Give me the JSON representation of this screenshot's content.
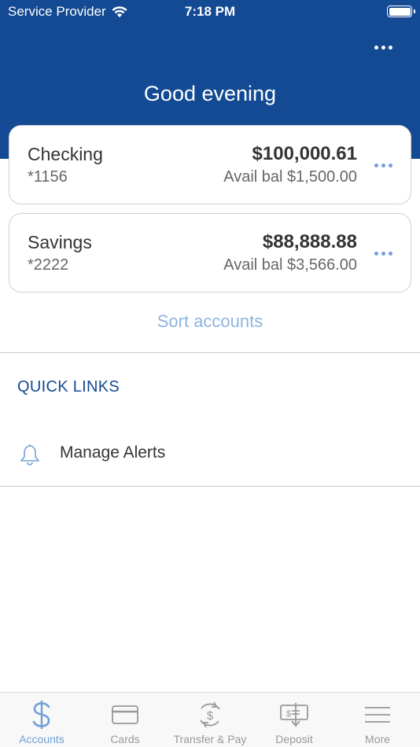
{
  "status_bar": {
    "carrier": "Service Provider",
    "time": "7:18 PM"
  },
  "header": {
    "greeting": "Good evening"
  },
  "accounts": [
    {
      "name": "Checking",
      "number": "*1156",
      "balance": "$100,000.61",
      "available": "Avail bal $1,500.00"
    },
    {
      "name": "Savings",
      "number": "*2222",
      "balance": "$88,888.88",
      "available": "Avail bal $3,566.00"
    }
  ],
  "sort_label": "Sort accounts",
  "quick_links": {
    "title": "QUICK LINKS",
    "items": [
      {
        "label": "Manage Alerts",
        "icon": "bell-icon"
      }
    ]
  },
  "tab_bar": {
    "items": [
      {
        "label": "Accounts",
        "icon": "dollar-icon",
        "active": true
      },
      {
        "label": "Cards",
        "icon": "card-icon",
        "active": false
      },
      {
        "label": "Transfer & Pay",
        "icon": "transfer-icon",
        "active": false
      },
      {
        "label": "Deposit",
        "icon": "deposit-icon",
        "active": false
      },
      {
        "label": "More",
        "icon": "menu-icon",
        "active": false
      }
    ]
  },
  "colors": {
    "header_bg": "#134a93",
    "accent": "#6fa0d6",
    "link_light": "#8fb4de"
  }
}
